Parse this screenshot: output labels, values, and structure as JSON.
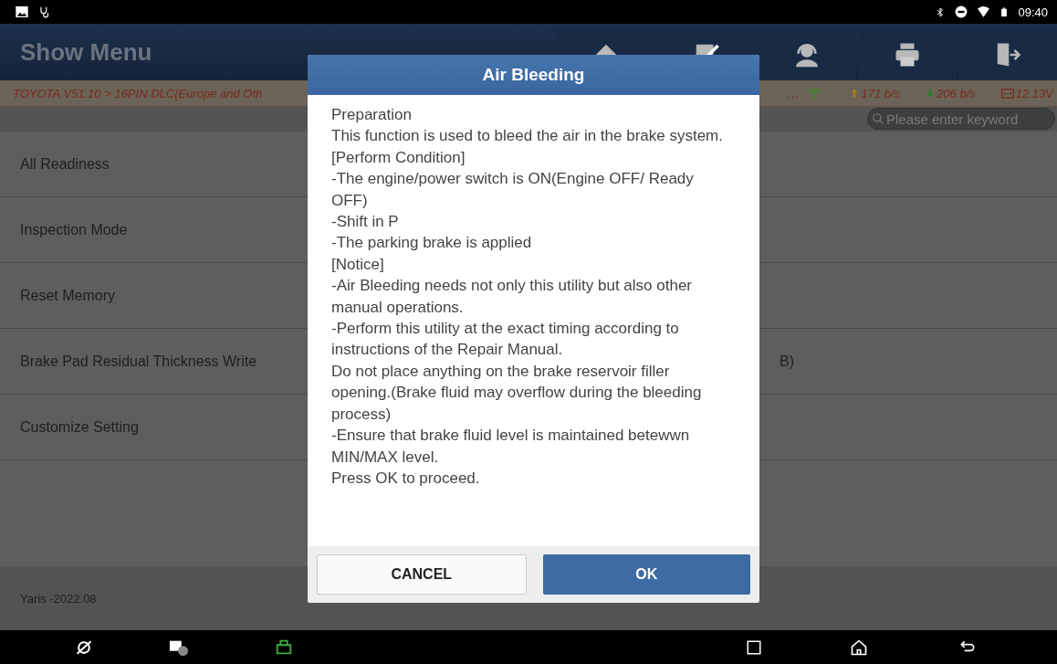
{
  "status_bar": {
    "time": "09:40"
  },
  "header": {
    "title": "Show Menu"
  },
  "breadcrumb": {
    "path": "TOYOTA V51.10 > 16PIN DLC(Europe and Oth",
    "path_tail": "…",
    "upload_rate": "171 b/s",
    "download_rate": "206 b/s",
    "voltage": "12.13V"
  },
  "search": {
    "placeholder": "Please enter keyword"
  },
  "menu_items": [
    {
      "label": "All Readiness"
    },
    {
      "label": "Inspection Mode"
    },
    {
      "label": "Reset Memory"
    },
    {
      "label": "Brake Pad Residual Thickness Write",
      "tail": "B)"
    },
    {
      "label": "Customize Setting"
    }
  ],
  "footer": {
    "vehicle": "Yaris -2022.08"
  },
  "dialog": {
    "title": "Air Bleeding",
    "lines": [
      "Preparation",
      "This function is used to bleed the air in the brake system.",
      "[Perform Condition]",
      "-The engine/power switch is ON(Engine OFF/ Ready OFF)",
      "-Shift in P",
      "-The parking brake is applied",
      "[Notice]",
      "-Air Bleeding needs not only this utility but also other manual operations.",
      "-Perform this utility at the exact timing according to instructions of the Repair Manual.",
      "Do not place anything on the brake reservoir filler opening.(Brake fluid may overflow during the bleeding process)",
      "-Ensure that brake fluid level is maintained betewwn MIN/MAX level.",
      "Press OK to proceed."
    ],
    "buttons": [
      {
        "label": "CANCEL",
        "kind": "secondary"
      },
      {
        "label": "OK",
        "kind": "primary"
      }
    ]
  }
}
